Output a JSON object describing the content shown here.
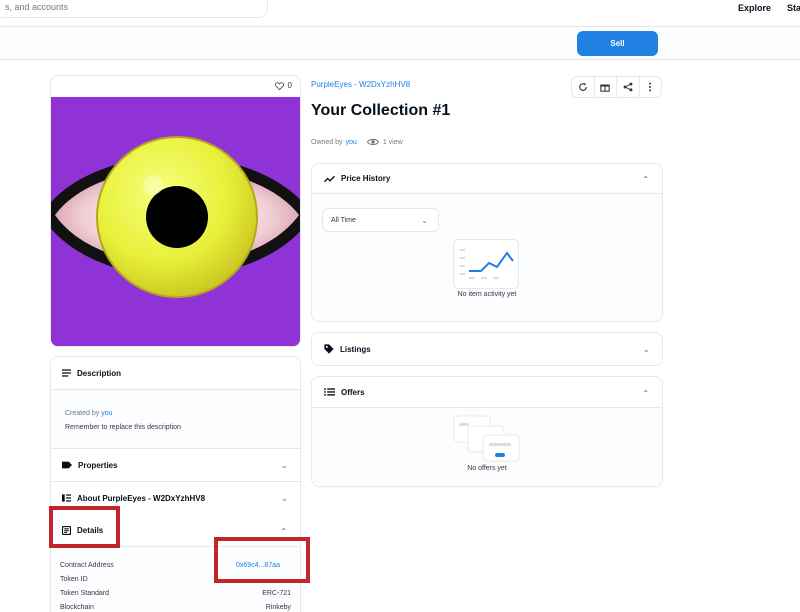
{
  "header": {
    "search_placeholder": "s, and accounts",
    "nav": [
      "Explore",
      "Sta"
    ]
  },
  "sellbar": {
    "sell_label": "Sell"
  },
  "image_card": {
    "favorite_count": "0"
  },
  "left": {
    "description": {
      "title": "Description",
      "created_by_prefix": "Created by",
      "created_by_user": "you",
      "text": "Remember to replace this description"
    },
    "properties": {
      "title": "Properties"
    },
    "about": {
      "title": "About PurpleEyes - W2DxYzhHV8"
    },
    "details": {
      "title": "Details",
      "rows": [
        {
          "label": "Contract Address",
          "value": "0x69c4...87aa"
        },
        {
          "label": "Token ID",
          "value": ""
        },
        {
          "label": "Token Standard",
          "value": "ERC-721"
        },
        {
          "label": "Blockchain",
          "value": "Rinkeby"
        }
      ]
    }
  },
  "item": {
    "collection": "PurpleEyes - W2DxYzhHV8",
    "title": "Your Collection #1",
    "owned_by_prefix": "Owned by",
    "owner": "you",
    "views": "1 view"
  },
  "toolbar": {
    "icons": [
      "refresh-icon",
      "gift-icon",
      "share-icon",
      "more-icon"
    ]
  },
  "price_history": {
    "title": "Price History",
    "range": "All Time",
    "empty": "No item activity yet"
  },
  "listings": {
    "title": "Listings"
  },
  "offers": {
    "title": "Offers",
    "empty": "No offers yet"
  },
  "colors": {
    "accent": "#2081e2",
    "annotation": "#c2262b",
    "nft_background": "#8f33d6"
  }
}
